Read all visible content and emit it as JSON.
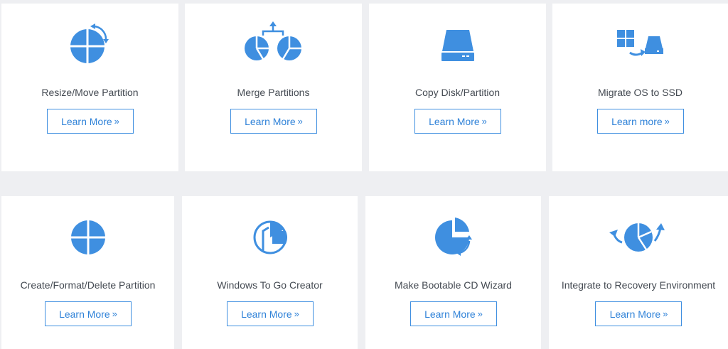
{
  "cards": [
    {
      "title": "Resize/Move Partition",
      "button": "Learn More",
      "icon": "resize-partition-icon"
    },
    {
      "title": "Merge Partitions",
      "button": "Learn More",
      "icon": "merge-partitions-icon"
    },
    {
      "title": "Copy Disk/Partition",
      "button": "Learn More",
      "icon": "disk-drive-icon"
    },
    {
      "title": "Migrate OS to SSD",
      "button": "Learn more",
      "icon": "migrate-os-icon"
    },
    {
      "title": "Create/Format/Delete Partition",
      "button": "Learn More",
      "icon": "partition-pie-icon"
    },
    {
      "title": "Windows To Go Creator",
      "button": "Learn More",
      "icon": "windows-to-go-icon"
    },
    {
      "title": "Make Bootable CD Wizard",
      "button": "Learn More",
      "icon": "bootable-cd-icon"
    },
    {
      "title": "Integrate to Recovery Environment",
      "button": "Learn More",
      "icon": "recovery-environment-icon"
    }
  ],
  "button_arrow": "»",
  "colors": {
    "accent": "#3f8fe0",
    "background": "#eeeff2",
    "card": "#ffffff",
    "text": "#444a52"
  }
}
